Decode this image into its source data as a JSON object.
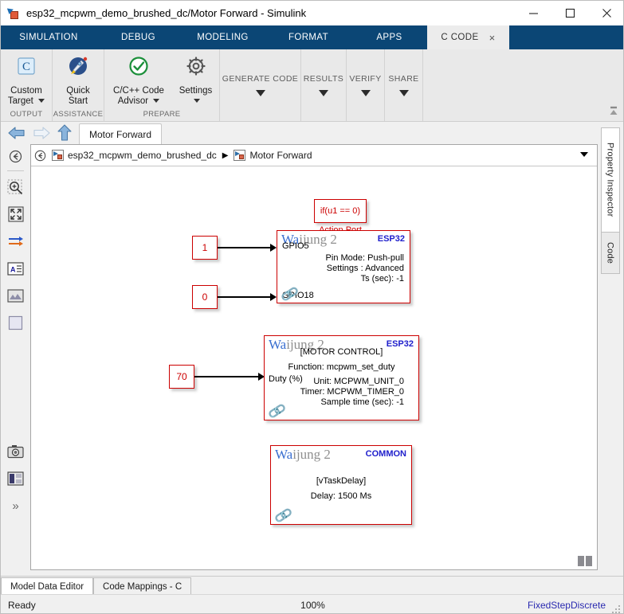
{
  "window": {
    "title": "esp32_mcpwm_demo_brushed_dc/Motor Forward - Simulink",
    "minimize_label": "Minimize",
    "maximize_label": "Maximize",
    "close_label": "Close"
  },
  "ribbon": {
    "tabs": [
      {
        "label": "SIMULATION",
        "active": false
      },
      {
        "label": "DEBUG",
        "active": false
      },
      {
        "label": "MODELING",
        "active": false
      },
      {
        "label": "FORMAT",
        "active": false
      },
      {
        "label": "APPS",
        "active": false
      },
      {
        "label": "C CODE",
        "active": true
      }
    ],
    "tab_close_label": "×",
    "groups": [
      {
        "name": "OUTPUT",
        "items": [
          {
            "label": "Custom\nTarget",
            "icon": "c-target-icon",
            "has_caret": true
          }
        ]
      },
      {
        "name": "ASSISTANCE",
        "items": [
          {
            "label": "Quick\nStart",
            "icon": "rocket-icon",
            "has_caret": false
          }
        ]
      },
      {
        "name": "PREPARE",
        "items": [
          {
            "label": "C/C++ Code\nAdvisor",
            "icon": "check-circle-icon",
            "has_caret": true
          },
          {
            "label": "Settings",
            "icon": "gear-icon",
            "has_caret": true
          }
        ]
      }
    ],
    "lazy_groups": [
      {
        "label": "GENERATE CODE"
      },
      {
        "label": "RESULTS"
      },
      {
        "label": "VERIFY"
      },
      {
        "label": "SHARE"
      }
    ]
  },
  "nav": {
    "back_label": "Back",
    "forward_label": "Forward",
    "up_label": "Up to Parent",
    "tab_label": "Motor Forward"
  },
  "breadcrumb": {
    "root": "esp32_mcpwm_demo_brushed_dc",
    "separator": "▶",
    "current": "Motor Forward"
  },
  "left_rail": {
    "items": [
      {
        "name": "navigate-back-icon",
        "glyph": "←"
      },
      {
        "name": "zoom-in-icon",
        "glyph": ""
      },
      {
        "name": "fit-to-view-icon",
        "glyph": ""
      },
      {
        "name": "signal-lines-icon",
        "glyph": ""
      },
      {
        "name": "annotation-icon",
        "glyph": "A"
      },
      {
        "name": "image-icon",
        "glyph": ""
      },
      {
        "name": "area-icon",
        "glyph": ""
      },
      {
        "name": "camera-icon",
        "glyph": ""
      },
      {
        "name": "layout-icon",
        "glyph": ""
      },
      {
        "name": "more-chevrons-icon",
        "glyph": "»"
      }
    ]
  },
  "right_rail": {
    "tabs": [
      {
        "label": "Property Inspector",
        "selected": true
      },
      {
        "label": "Code",
        "selected": false
      }
    ]
  },
  "canvas": {
    "action_port": {
      "text": "if(u1 == 0)",
      "caption": "Action Port"
    },
    "constants": [
      {
        "value": "1"
      },
      {
        "value": "0"
      },
      {
        "value": "70"
      }
    ],
    "blocks": [
      {
        "id": "gpio-block",
        "brand": "Waijung 2",
        "brand_highlight": "Wa",
        "brand_rest": "ijung 2",
        "badge": "ESP32",
        "lines": [
          "Pin Mode: Push-pull",
          "Settings : Advanced",
          "Ts (sec): -1"
        ],
        "ports": [
          "GPIO5",
          "GPIO18"
        ],
        "link_icon": "link-icon"
      },
      {
        "id": "motor-control-block",
        "brand": "Waijung 2",
        "brand_highlight": "Wa",
        "brand_rest": "ijung 2",
        "badge": "ESP32",
        "subtitle": "[MOTOR CONTROL]",
        "lines": [
          "Function: mcpwm_set_duty",
          "Unit: MCPWM_UNIT_0",
          "Timer: MCPWM_TIMER_0",
          "Sample time (sec): -1"
        ],
        "ports": [
          "Duty (%)"
        ],
        "link_icon": "link-icon"
      },
      {
        "id": "delay-block",
        "brand": "Waijung 2",
        "brand_highlight": "Wa",
        "brand_rest": "ijung 2",
        "badge": "COMMON",
        "lines": [
          "[vTaskDelay]",
          "Delay: 1500 Ms"
        ],
        "ports": [],
        "link_icon": "link-icon"
      }
    ]
  },
  "bottom_tabs": [
    {
      "label": "Model Data Editor",
      "active": true
    },
    {
      "label": "Code Mappings - C",
      "active": false
    }
  ],
  "status": {
    "message": "Ready",
    "zoom": "100%",
    "solver": "FixedStepDiscrete"
  },
  "colors": {
    "ribbon_blue": "#0b4675",
    "block_red": "#cc0000",
    "badge_blue": "#2020cc",
    "status_link": "#2a2ab0"
  }
}
